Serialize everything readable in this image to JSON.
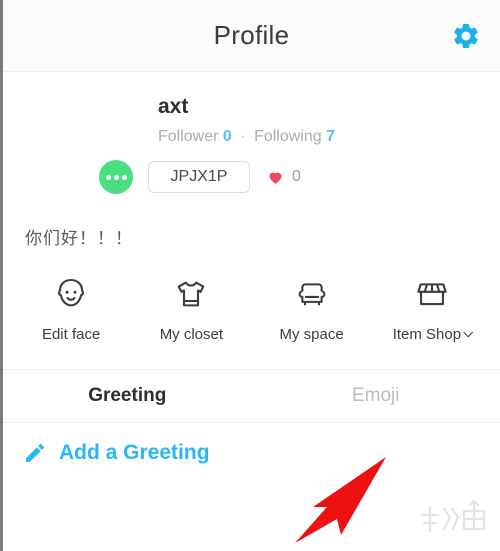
{
  "header": {
    "title": "Profile",
    "settings_icon": "gear-icon"
  },
  "profile": {
    "nickname": "axt",
    "follower_label": "Follower",
    "follower_count": "0",
    "separator": "·",
    "following_label": "Following",
    "following_count": "7",
    "chat_icon": "chat-dots-icon",
    "user_id": "JPJX1P",
    "heart_icon": "heart-icon",
    "like_count": "0",
    "status_message": "你们好！！！"
  },
  "menu": {
    "items": [
      {
        "label": "Edit face",
        "icon": "face-icon",
        "has_chevron": false
      },
      {
        "label": "My closet",
        "icon": "tshirt-icon",
        "has_chevron": false
      },
      {
        "label": "My space",
        "icon": "armchair-icon",
        "has_chevron": false
      },
      {
        "label": "Item Shop",
        "icon": "storefront-icon",
        "has_chevron": true
      }
    ]
  },
  "tabs": [
    {
      "label": "Greeting",
      "active": true
    },
    {
      "label": "Emoji",
      "active": false
    }
  ],
  "add_greeting": {
    "label": "Add a Greeting",
    "icon": "pencil-icon"
  },
  "annotations": {
    "arrow_icon": "red-arrow-pointer",
    "watermark_icon": "site-watermark-logo"
  },
  "colors": {
    "accent_blue": "#29b6f6",
    "gear_blue": "#1cb0e8",
    "count_blue": "#4fc3f7",
    "chat_green": "#4ade80",
    "heart_red": "#f0465f",
    "arrow_red": "#ef1111",
    "text_dark": "#2e2e2e",
    "text_muted": "#a7adb4"
  }
}
